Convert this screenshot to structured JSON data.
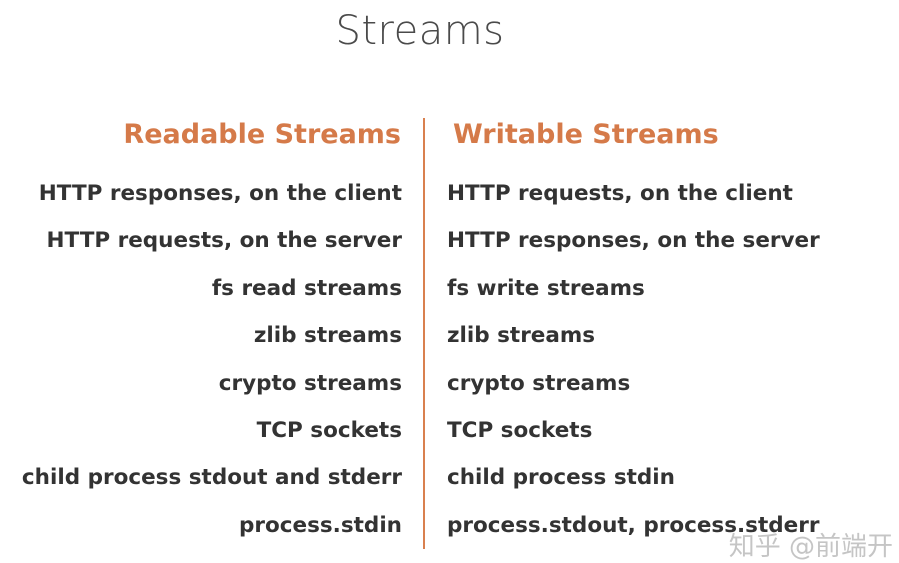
{
  "title": "Streams",
  "readable": {
    "heading": "Readable Streams",
    "items": [
      "HTTP responses, on the client",
      "HTTP requests, on the server",
      "fs read streams",
      "zlib streams",
      "crypto streams",
      "TCP sockets",
      "child process stdout and stderr",
      "process.stdin"
    ]
  },
  "writable": {
    "heading": "Writable Streams",
    "items": [
      "HTTP requests, on the client",
      "HTTP responses, on the server",
      "fs write streams",
      "zlib streams",
      "crypto streams",
      "TCP sockets",
      "child process stdin",
      "process.stdout, process.stderr"
    ]
  },
  "watermark": "知乎 @前端开",
  "colors": {
    "accent": "#d57a49",
    "text": "#333333",
    "title": "#4a4a4a"
  }
}
